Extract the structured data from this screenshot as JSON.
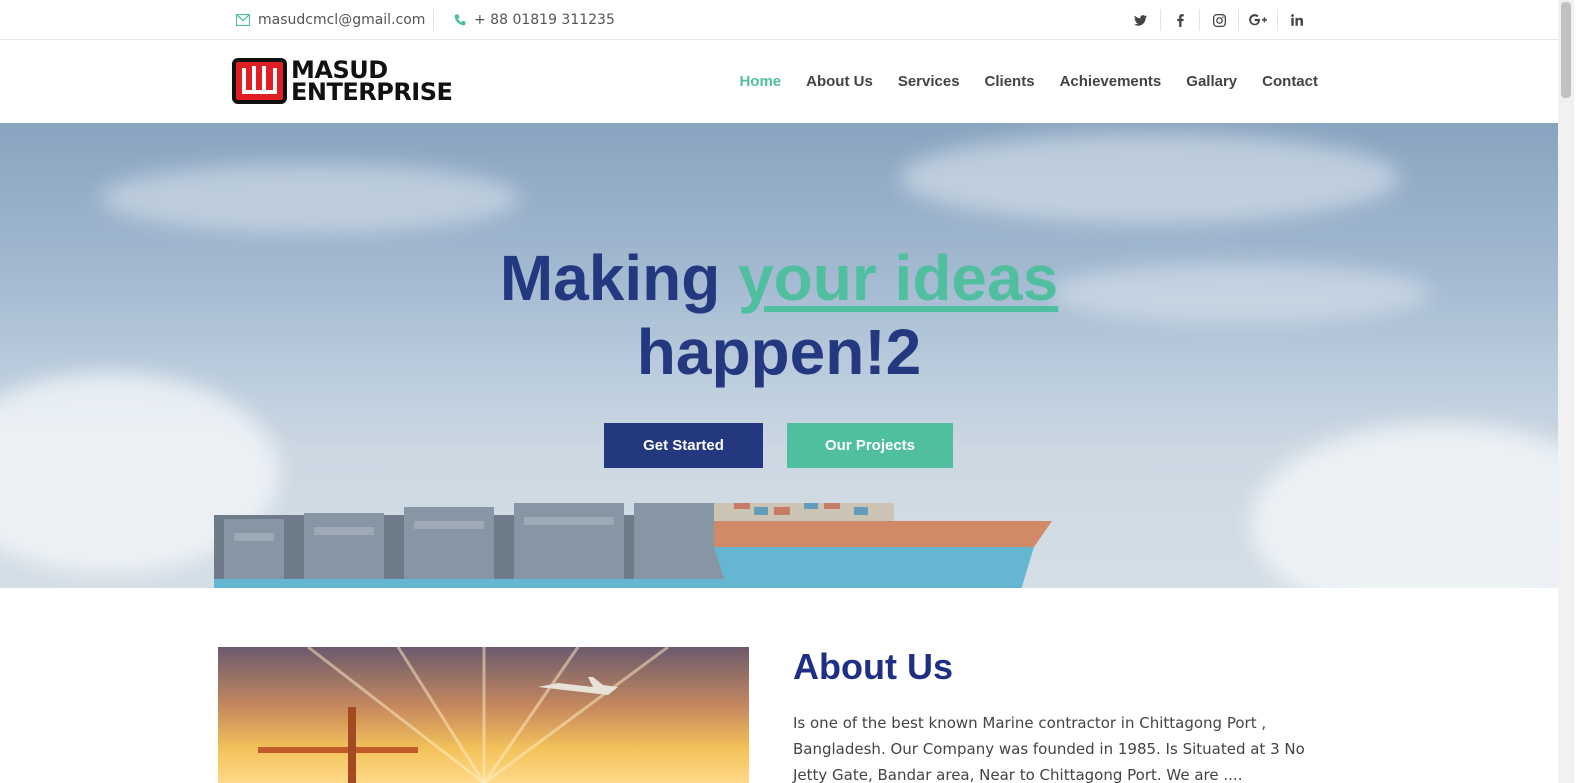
{
  "topbar": {
    "email": "masudcmcl@gmail.com",
    "phone": "+ 88 01819 311235",
    "social": [
      {
        "icon": "twitter-icon",
        "glyph": "🐦"
      },
      {
        "icon": "facebook-icon",
        "glyph": "f"
      },
      {
        "icon": "instagram-icon",
        "glyph": "◎"
      },
      {
        "icon": "google-plus-icon",
        "glyph": "G+"
      },
      {
        "icon": "linkedin-icon",
        "glyph": "in"
      }
    ]
  },
  "logo": {
    "line1": "MASUD",
    "line2": "ENTERPRISE"
  },
  "nav": {
    "items": [
      "Home",
      "About Us",
      "Services",
      "Clients",
      "Achievements",
      "Gallary",
      "Contact"
    ],
    "active": "Home"
  },
  "hero": {
    "title_pre": "Making ",
    "title_highlight": "your ideas",
    "title_post": "happen!2",
    "btn_primary": "Get Started",
    "btn_secondary": "Our Projects"
  },
  "about": {
    "title": "About Us",
    "text": "Is one of the best known Marine contractor in Chittagong Port , Bangladesh. Our Company was founded in 1985. Is Situated at 3 No Jetty Gate, Bandar area, Near to Chittagong Port. We are ...."
  },
  "colors": {
    "accent": "#4fbf9f",
    "primary": "#24387f",
    "brand_red": "#e01e24"
  }
}
